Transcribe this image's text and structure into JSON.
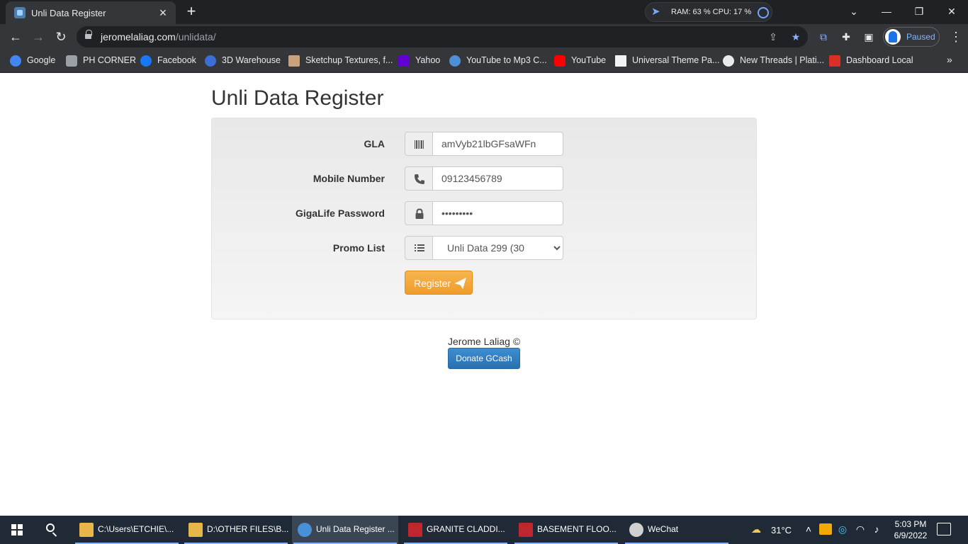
{
  "browser": {
    "tab_title": "Unli Data Register",
    "new_tab": "+",
    "extension": {
      "text": "RAM: 63 % CPU: 17 %"
    },
    "url_host": "jeromelaliag.com",
    "url_path": "/unlidata/",
    "profile_status": "Paused",
    "bookmarks": [
      {
        "label": "Google",
        "icon_color": "#4285f4"
      },
      {
        "label": "PH CORNER",
        "icon_color": "#9aa0a6"
      },
      {
        "label": "Facebook",
        "icon_color": "#1877f2"
      },
      {
        "label": "3D Warehouse",
        "icon_color": "#3a6fd8"
      },
      {
        "label": "Sketchup Textures, f...",
        "icon_color": "#c8a27a"
      },
      {
        "label": "Yahoo",
        "icon_color": "#6001d2"
      },
      {
        "label": "YouTube to Mp3 C...",
        "icon_color": "#4f8fd8"
      },
      {
        "label": "YouTube",
        "icon_color": "#ff0000"
      },
      {
        "label": "Universal Theme Pa...",
        "icon_color": "#f1f3f4"
      },
      {
        "label": "New Threads | Plati...",
        "icon_color": "#e8eaed"
      },
      {
        "label": "Dashboard Local",
        "icon_color": "#d93025"
      }
    ]
  },
  "page": {
    "title": "Unli Data Register",
    "form": {
      "gla_label": "GLA",
      "gla_value": "amVyb21lbGFsaWFn",
      "mobile_label": "Mobile Number",
      "mobile_value": "09123456789",
      "password_label": "GigaLife Password",
      "password_value": "•••••••••",
      "promo_label": "Promo List",
      "promo_selected": "Unli Data 299 (30",
      "register_label": "Register"
    },
    "footer_text": "Jerome Laliag ©",
    "donate_label": "Donate GCash"
  },
  "taskbar": {
    "items": [
      {
        "label": "C:\\Users\\ETCHIE\\...",
        "icon": "folder-icon",
        "active": false
      },
      {
        "label": "D:\\OTHER FILES\\B...",
        "icon": "folder-icon",
        "active": false
      },
      {
        "label": "Unli Data Register ...",
        "icon": "chrome-icon",
        "active": true
      },
      {
        "label": "GRANITE CLADDI...",
        "icon": "autocad-icon",
        "active": false
      },
      {
        "label": "BASEMENT FLOO...",
        "icon": "autocad-icon",
        "active": false
      },
      {
        "label": "WeChat",
        "icon": "wechat-icon",
        "active": false
      }
    ],
    "temperature": "31°C",
    "time": "5:03 PM",
    "date": "6/9/2022"
  }
}
